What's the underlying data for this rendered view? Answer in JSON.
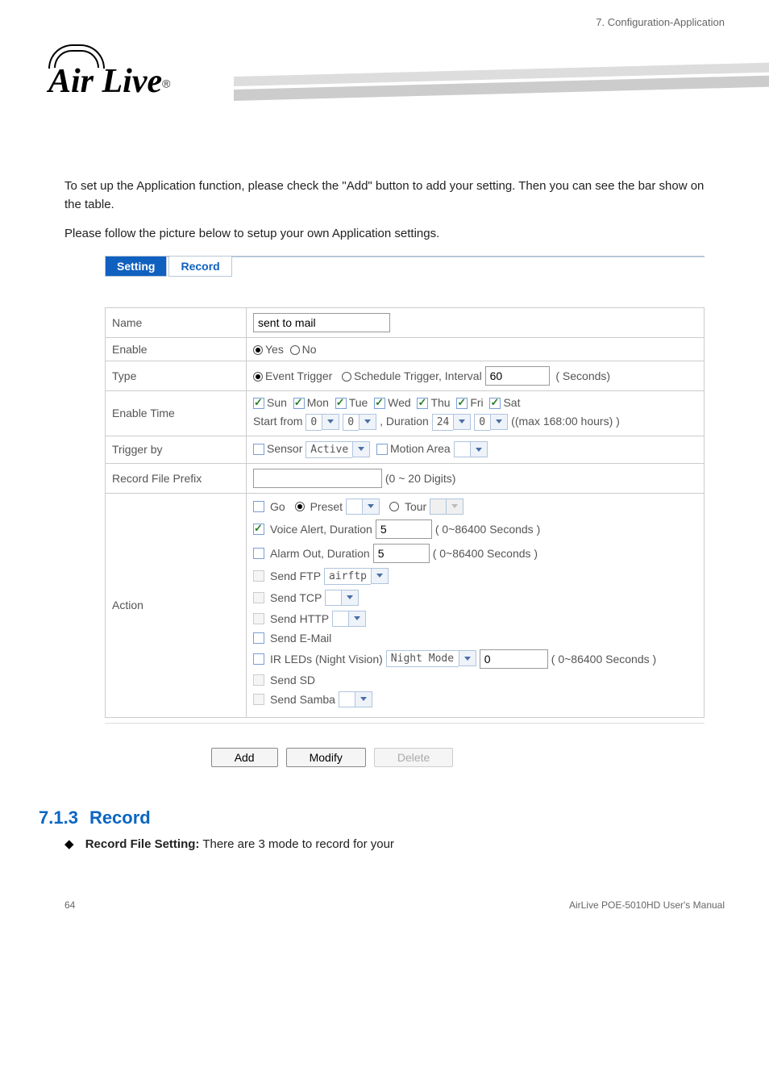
{
  "brand": "Air Live",
  "chapter_header": "7. Configuration-Application",
  "intro": {
    "p1": "To set up the Application function, please check the \"Add\" button to add your setting. Then you can see the bar show on the table.",
    "p2": "Please follow the picture below to setup your own Application settings."
  },
  "tabs": {
    "setting": "Setting",
    "record": "Record"
  },
  "rows": {
    "name": {
      "label": "Name",
      "value": "sent to mail"
    },
    "enable": {
      "label": "Enable",
      "yes": "Yes",
      "no": "No"
    },
    "type": {
      "label": "Type",
      "event": "Event Trigger",
      "schedule": "Schedule Trigger, Interval",
      "interval_value": "60",
      "unit": "( Seconds)"
    },
    "enable_time": {
      "label": "Enable Time",
      "days": [
        "Sun",
        "Mon",
        "Tue",
        "Wed",
        "Thu",
        "Fri",
        "Sat"
      ],
      "start_from": "Start from",
      "hh": "0",
      "mm": "0",
      "duration_label": ", Duration",
      "dur_h": "24",
      "dur_m": "0",
      "max": "((max 168:00 hours) )"
    },
    "trigger_by": {
      "label": "Trigger by",
      "sensor": "Sensor",
      "sensor_val": "Active",
      "motion": "Motion Area"
    },
    "prefix": {
      "label": "Record File Prefix",
      "value": "",
      "hint": "(0 ~ 20 Digits)"
    },
    "action": {
      "label": "Action",
      "go": "Go",
      "preset": "Preset",
      "tour": "Tour",
      "voice": "Voice Alert, Duration",
      "voice_val": "5",
      "voice_unit": "( 0~86400 Seconds )",
      "alarm": "Alarm Out, Duration",
      "alarm_val": "5",
      "alarm_unit": "( 0~86400 Seconds )",
      "ftp": "Send FTP",
      "ftp_val": "airftp",
      "tcp": "Send TCP",
      "http": "Send HTTP",
      "email": "Send E-Mail",
      "irled": "IR LEDs (Night Vision)",
      "irled_mode": "Night Mode",
      "irled_val": "0",
      "irled_unit": "( 0~86400 Seconds )",
      "sd": "Send SD",
      "samba": "Send Samba"
    }
  },
  "buttons": {
    "add": "Add",
    "modify": "Modify",
    "delete": "Delete"
  },
  "section": {
    "num": "7.1.3",
    "title": "Record",
    "bullet_label": "Record File Setting:",
    "bullet_text": "There are 3 mode to record for your"
  },
  "footer": {
    "page": "64",
    "manual": "AirLive POE-5010HD User's Manual"
  }
}
